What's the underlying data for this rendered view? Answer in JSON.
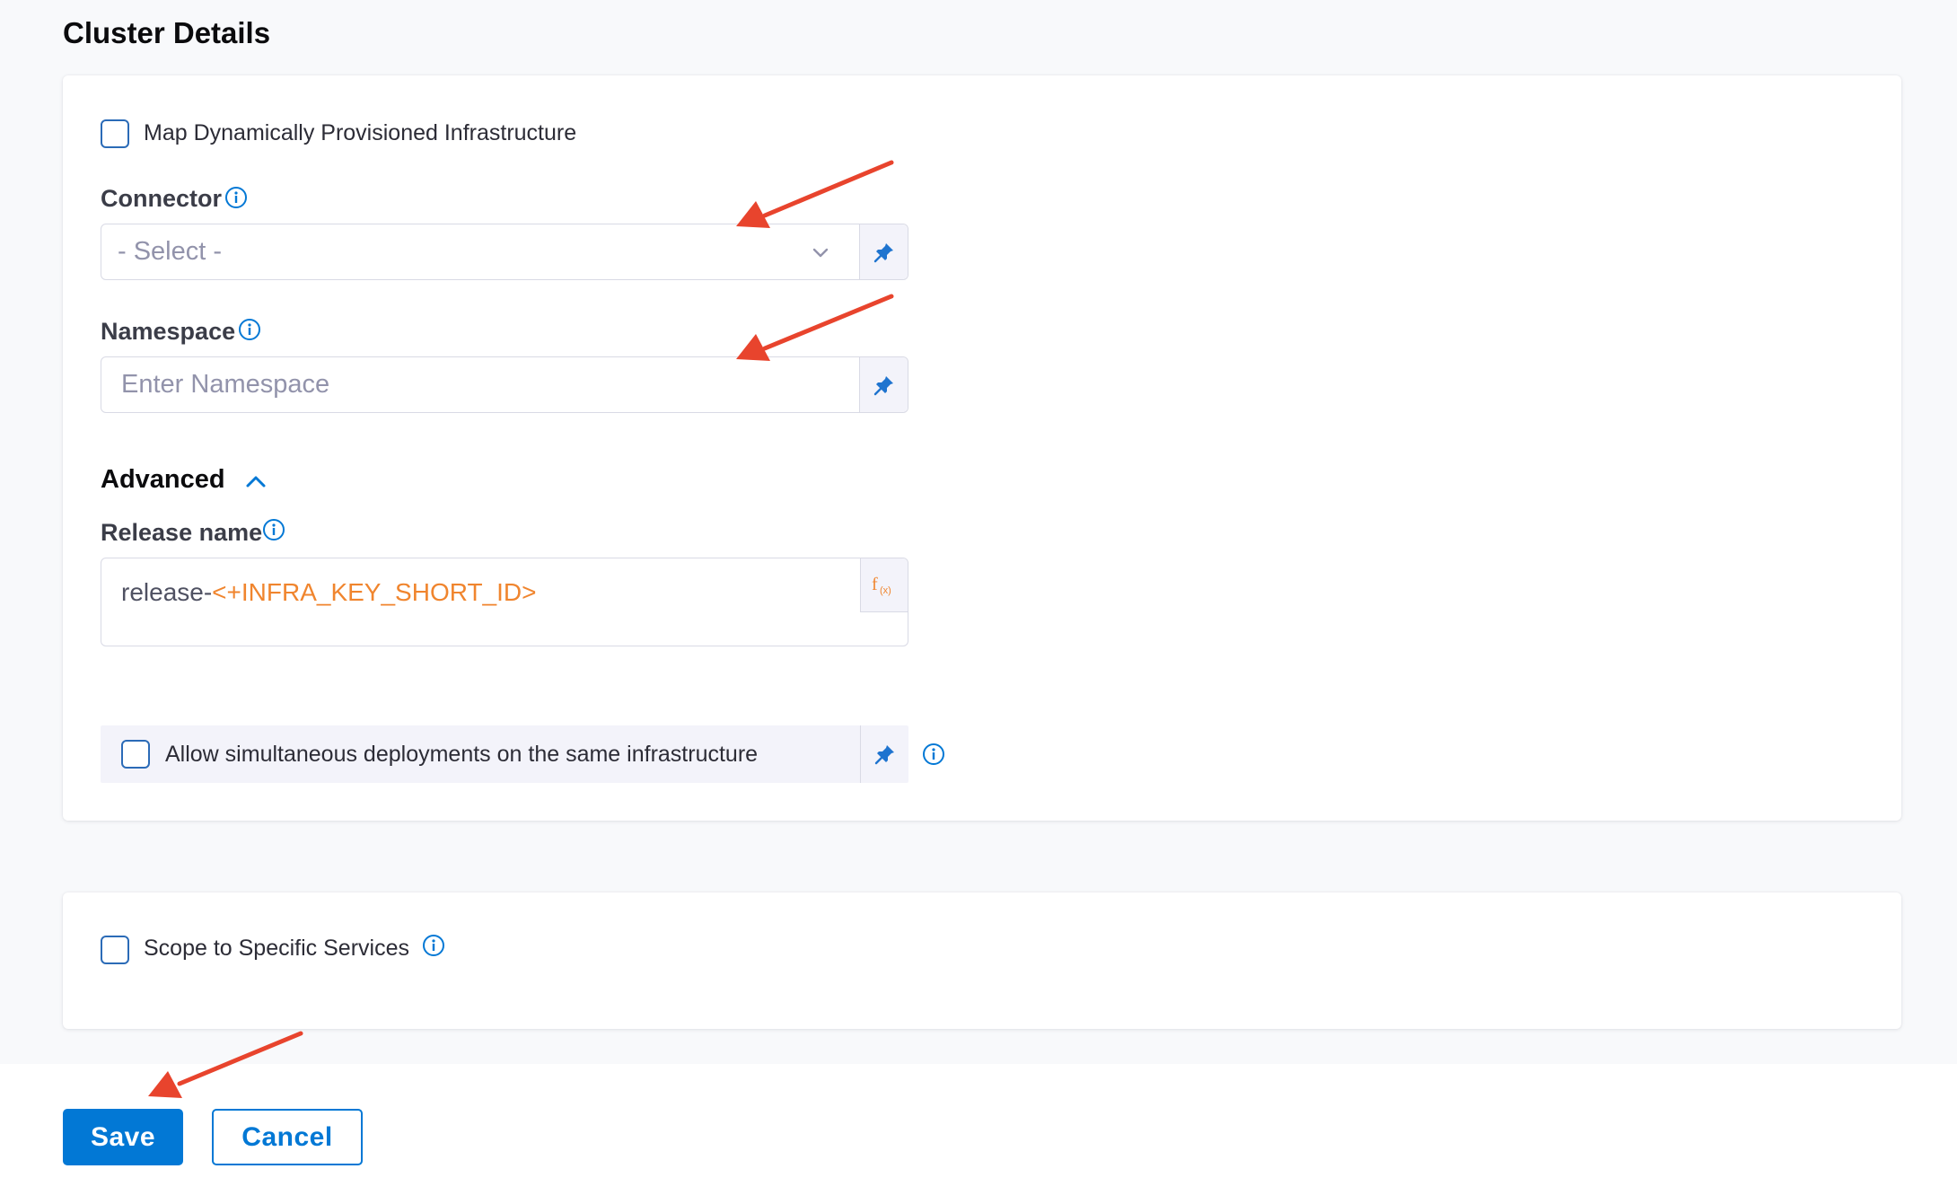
{
  "section": {
    "title": "Cluster Details"
  },
  "map_infra": {
    "label": "Map Dynamically Provisioned Infrastructure",
    "checked": false
  },
  "connector": {
    "label": "Connector",
    "placeholder": "- Select -"
  },
  "namespace": {
    "label": "Namespace",
    "placeholder": "Enter Namespace"
  },
  "advanced": {
    "title": "Advanced",
    "release_name": {
      "label": "Release name",
      "value_prefix": "release-",
      "value_expression": "<+INFRA_KEY_SHORT_ID>"
    }
  },
  "allow_simultaneous": {
    "label": "Allow simultaneous deployments on the same infrastructure",
    "checked": false
  },
  "scope": {
    "label": "Scope to Specific Services",
    "checked": false
  },
  "actions": {
    "save_label": "Save",
    "cancel_label": "Cancel"
  },
  "colors": {
    "primary": "#0278d5",
    "annotation_arrow": "#e8442d",
    "expression": "#f0852e"
  }
}
